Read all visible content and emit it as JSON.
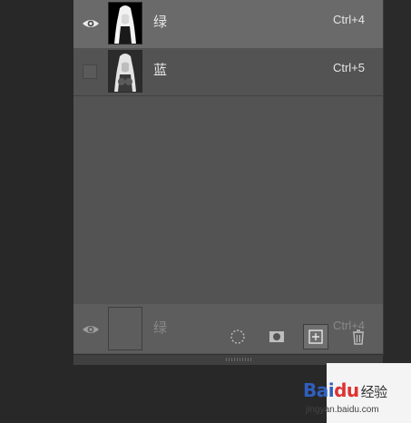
{
  "channels": [
    {
      "name": "绿",
      "shortcut": "Ctrl+4",
      "visible": true,
      "selected": true
    },
    {
      "name": "蓝",
      "shortcut": "Ctrl+5",
      "visible": false,
      "selected": false
    }
  ],
  "drag_ghost": {
    "name": "绿",
    "shortcut": "Ctrl+4"
  },
  "toolbar": {
    "buttons": [
      {
        "name": "load-channel-as-selection",
        "icon": "dotted-circle-icon"
      },
      {
        "name": "save-selection-as-channel",
        "icon": "mask-icon"
      },
      {
        "name": "create-new-channel",
        "icon": "new-channel-icon"
      },
      {
        "name": "delete-channel",
        "icon": "trash-icon"
      }
    ]
  },
  "watermark": {
    "brand": "Bai",
    "paw": "du",
    "cn": "经验",
    "url": "jingyan.baidu.com"
  },
  "colors": {
    "panel_bg": "#535353",
    "selected_row": "#6a6a6a",
    "text": "#e6e6e6",
    "background": "#282828"
  }
}
